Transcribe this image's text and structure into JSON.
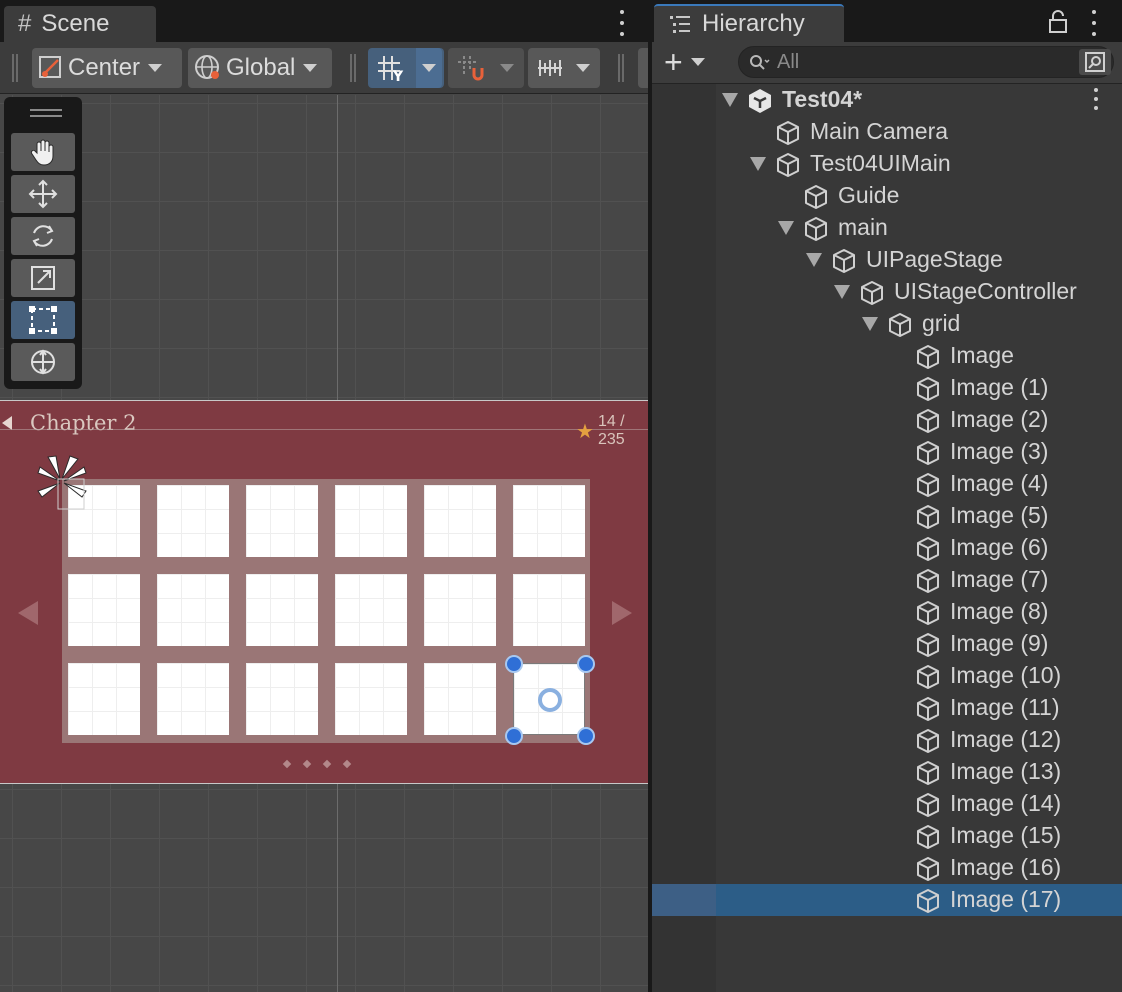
{
  "scene": {
    "tab_label": "Scene",
    "tab_icon": "#",
    "pivot_mode_label": "Center",
    "pivot_rotation_label": "Global",
    "chapter_title": "Chapter 2",
    "stars_text": "14 / 235",
    "grid_rows": 3,
    "grid_cols": 6
  },
  "hierarchy": {
    "tab_label": "Hierarchy",
    "add_label": "+",
    "search_placeholder": "All",
    "items": [
      {
        "label": "Test04*",
        "depth": 0,
        "expanded": true,
        "root": true
      },
      {
        "label": "Main Camera",
        "depth": 1
      },
      {
        "label": "Test04UIMain",
        "depth": 1,
        "expanded": true
      },
      {
        "label": "Guide",
        "depth": 2
      },
      {
        "label": "main",
        "depth": 2,
        "expanded": true
      },
      {
        "label": "UIPageStage",
        "depth": 3,
        "expanded": true
      },
      {
        "label": "UIStageController",
        "depth": 4,
        "expanded": true
      },
      {
        "label": "grid",
        "depth": 5,
        "expanded": true
      },
      {
        "label": "Image",
        "depth": 6
      },
      {
        "label": "Image (1)",
        "depth": 6
      },
      {
        "label": "Image (2)",
        "depth": 6
      },
      {
        "label": "Image (3)",
        "depth": 6
      },
      {
        "label": "Image (4)",
        "depth": 6
      },
      {
        "label": "Image (5)",
        "depth": 6
      },
      {
        "label": "Image (6)",
        "depth": 6
      },
      {
        "label": "Image (7)",
        "depth": 6
      },
      {
        "label": "Image (8)",
        "depth": 6
      },
      {
        "label": "Image (9)",
        "depth": 6
      },
      {
        "label": "Image (10)",
        "depth": 6
      },
      {
        "label": "Image (11)",
        "depth": 6
      },
      {
        "label": "Image (12)",
        "depth": 6
      },
      {
        "label": "Image (13)",
        "depth": 6
      },
      {
        "label": "Image (14)",
        "depth": 6
      },
      {
        "label": "Image (15)",
        "depth": 6
      },
      {
        "label": "Image (16)",
        "depth": 6
      },
      {
        "label": "Image (17)",
        "depth": 6,
        "selected": true
      }
    ]
  },
  "colors": {
    "selection": "#2c5d87",
    "active_button": "#46607c",
    "canvas": "#7f3a42"
  }
}
